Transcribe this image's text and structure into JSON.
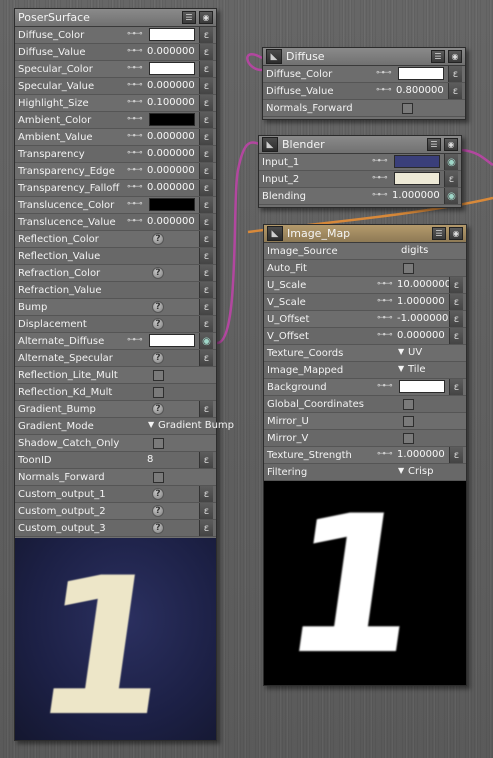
{
  "colors": {
    "wire_magenta": "#b2479f",
    "wire_orange": "#d8893a",
    "preview_navy": "#1c2045",
    "digit_cream": "#ede6c8"
  },
  "poser_surface": {
    "title": "PoserSurface",
    "rows": [
      {
        "label": "Diffuse_Color",
        "kind": "swatch",
        "color": "#ffffff"
      },
      {
        "label": "Diffuse_Value",
        "kind": "number",
        "value": "0.000000"
      },
      {
        "label": "Specular_Color",
        "kind": "swatch",
        "color": "#ffffff"
      },
      {
        "label": "Specular_Value",
        "kind": "number",
        "value": "0.000000"
      },
      {
        "label": "Highlight_Size",
        "kind": "number",
        "value": "0.100000"
      },
      {
        "label": "Ambient_Color",
        "kind": "swatch",
        "color": "#000000"
      },
      {
        "label": "Ambient_Value",
        "kind": "number",
        "value": "0.000000"
      },
      {
        "label": "Transparency",
        "kind": "number",
        "value": "0.000000"
      },
      {
        "label": "Transparency_Edge",
        "kind": "number",
        "value": "0.000000"
      },
      {
        "label": "Transparency_Falloff",
        "kind": "number",
        "value": "0.000000"
      },
      {
        "label": "Translucence_Color",
        "kind": "swatch",
        "color": "#000000"
      },
      {
        "label": "Translucence_Value",
        "kind": "number",
        "value": "0.000000"
      },
      {
        "label": "Reflection_Color",
        "kind": "help"
      },
      {
        "label": "Reflection_Value",
        "kind": "plain"
      },
      {
        "label": "Refraction_Color",
        "kind": "help"
      },
      {
        "label": "Refraction_Value",
        "kind": "plain"
      },
      {
        "label": "Bump",
        "kind": "help"
      },
      {
        "label": "Displacement",
        "kind": "help"
      },
      {
        "label": "Alternate_Diffuse",
        "kind": "swatch-linked",
        "color": "#ffffff"
      },
      {
        "label": "Alternate_Specular",
        "kind": "help"
      },
      {
        "label": "Reflection_Lite_Mult",
        "kind": "check"
      },
      {
        "label": "Reflection_Kd_Mult",
        "kind": "check"
      },
      {
        "label": "Gradient_Bump",
        "kind": "help"
      },
      {
        "label": "Gradient_Mode",
        "kind": "dropdown",
        "value": "Gradient Bump"
      },
      {
        "label": "Shadow_Catch_Only",
        "kind": "check"
      },
      {
        "label": "ToonID",
        "kind": "int",
        "value": "8"
      },
      {
        "label": "Normals_Forward",
        "kind": "check"
      },
      {
        "label": "Custom_output_1",
        "kind": "help"
      },
      {
        "label": "Custom_output_2",
        "kind": "help"
      },
      {
        "label": "Custom_output_3",
        "kind": "help"
      }
    ],
    "preview_digit": "1"
  },
  "diffuse": {
    "title": "Diffuse",
    "rows": [
      {
        "label": "Diffuse_Color",
        "kind": "swatch",
        "color": "#ffffff"
      },
      {
        "label": "Diffuse_Value",
        "kind": "number",
        "value": "0.800000"
      },
      {
        "label": "Normals_Forward",
        "kind": "check"
      }
    ]
  },
  "blender": {
    "title": "Blender",
    "rows": [
      {
        "label": "Input_1",
        "kind": "swatch-linked",
        "color": "#3a3f7a"
      },
      {
        "label": "Input_2",
        "kind": "swatch",
        "color": "#ede9d6"
      },
      {
        "label": "Blending",
        "kind": "number-linked",
        "value": "1.000000"
      }
    ]
  },
  "image_map": {
    "title": "Image_Map",
    "rows": [
      {
        "label": "Image_Source",
        "kind": "text",
        "value": "digits"
      },
      {
        "label": "Auto_Fit",
        "kind": "check"
      },
      {
        "label": "U_Scale",
        "kind": "number",
        "value": "10.000000"
      },
      {
        "label": "V_Scale",
        "kind": "number",
        "value": "1.000000"
      },
      {
        "label": "U_Offset",
        "kind": "number",
        "value": "-1.000000"
      },
      {
        "label": "V_Offset",
        "kind": "number",
        "value": "0.000000"
      },
      {
        "label": "Texture_Coords",
        "kind": "dropdown",
        "value": "UV"
      },
      {
        "label": "Image_Mapped",
        "kind": "dropdown",
        "value": "Tile"
      },
      {
        "label": "Background",
        "kind": "swatch",
        "color": "#ffffff"
      },
      {
        "label": "Global_Coordinates",
        "kind": "check"
      },
      {
        "label": "Mirror_U",
        "kind": "check"
      },
      {
        "label": "Mirror_V",
        "kind": "check"
      },
      {
        "label": "Texture_Strength",
        "kind": "number",
        "value": "1.000000"
      },
      {
        "label": "Filtering",
        "kind": "dropdown",
        "value": "Crisp"
      }
    ],
    "preview_digit": "1"
  }
}
